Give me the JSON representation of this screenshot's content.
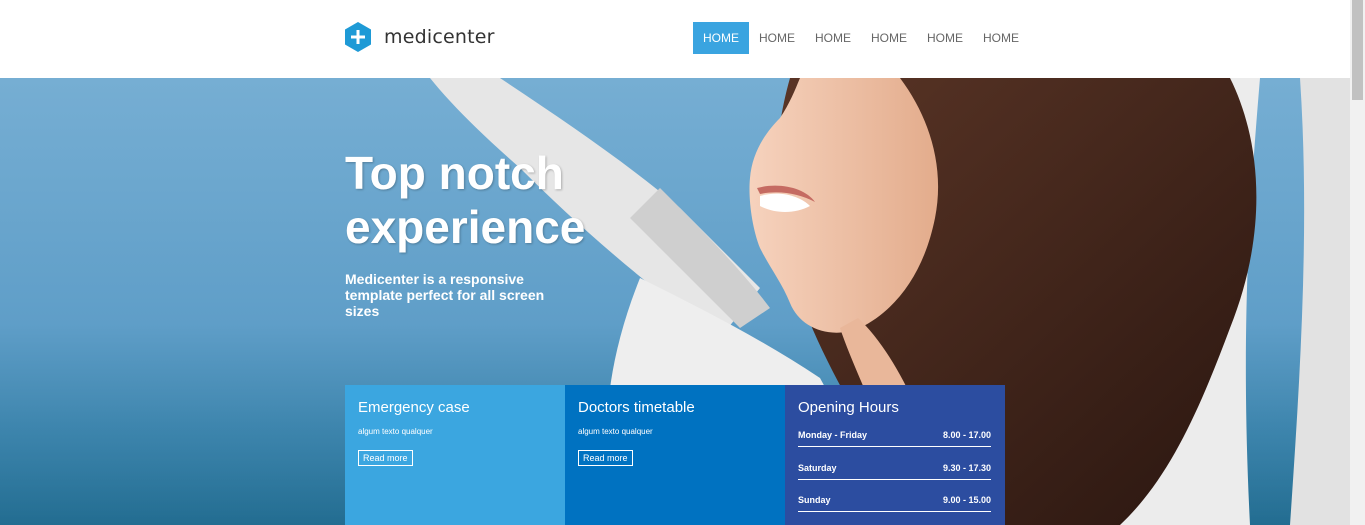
{
  "header": {
    "logo_text": "medicenter",
    "nav": [
      "HOME",
      "HOME",
      "HOME",
      "HOME",
      "HOME",
      "HOME"
    ]
  },
  "hero": {
    "headline_line1": "Top notch",
    "headline_line2": "experience",
    "subline": "Medicenter is a responsive template perfect for all screen sizes"
  },
  "boxes": {
    "emergency": {
      "title": "Emergency case",
      "text": "algum texto qualquer",
      "button": "Read more"
    },
    "timetable": {
      "title": "Doctors timetable",
      "text": "algum texto qualquer",
      "button": "Read more"
    },
    "hours": {
      "title": "Opening Hours",
      "rows": [
        {
          "day": "Monday - Friday",
          "time": "8.00 - 17.00"
        },
        {
          "day": "Saturday",
          "time": "9.30 - 17.30"
        },
        {
          "day": "Sunday",
          "time": "9.00 - 15.00"
        }
      ]
    }
  },
  "colors": {
    "accent": "#3aa4e0",
    "box_light_blue": "#3ba6e0",
    "box_mid_blue": "#0072c1",
    "box_dark_blue": "#2c4da0"
  }
}
